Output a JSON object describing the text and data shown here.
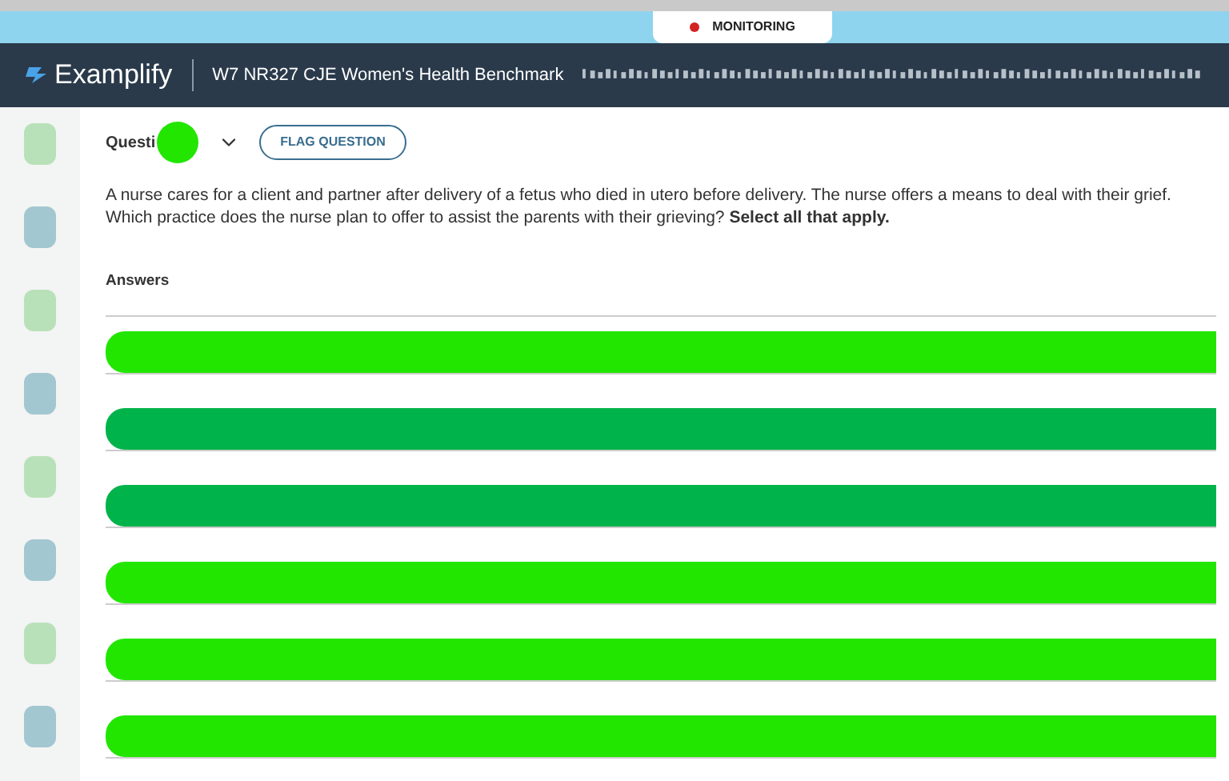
{
  "monitoring": {
    "label": "MONITORING"
  },
  "header": {
    "brand": "Examplify",
    "exam_title": "W7 NR327 CJE Women's Health Benchmark"
  },
  "question": {
    "label": "Questi",
    "flag_button": "FLAG QUESTION",
    "text": "A nurse cares for a client and partner after delivery of a fetus who died in utero before delivery. The nurse offers a means to deal with their grief. Which practice does the nurse plan to offer to assist the parents with their grieving? **Select all that apply.**"
  },
  "answers_label": "Answers",
  "answers": [
    {
      "color": "#22e600"
    },
    {
      "color": "#00b34a"
    },
    {
      "color": "#00b34a"
    },
    {
      "color": "#22e600"
    },
    {
      "color": "#22e600"
    },
    {
      "color": "#22e600"
    }
  ]
}
